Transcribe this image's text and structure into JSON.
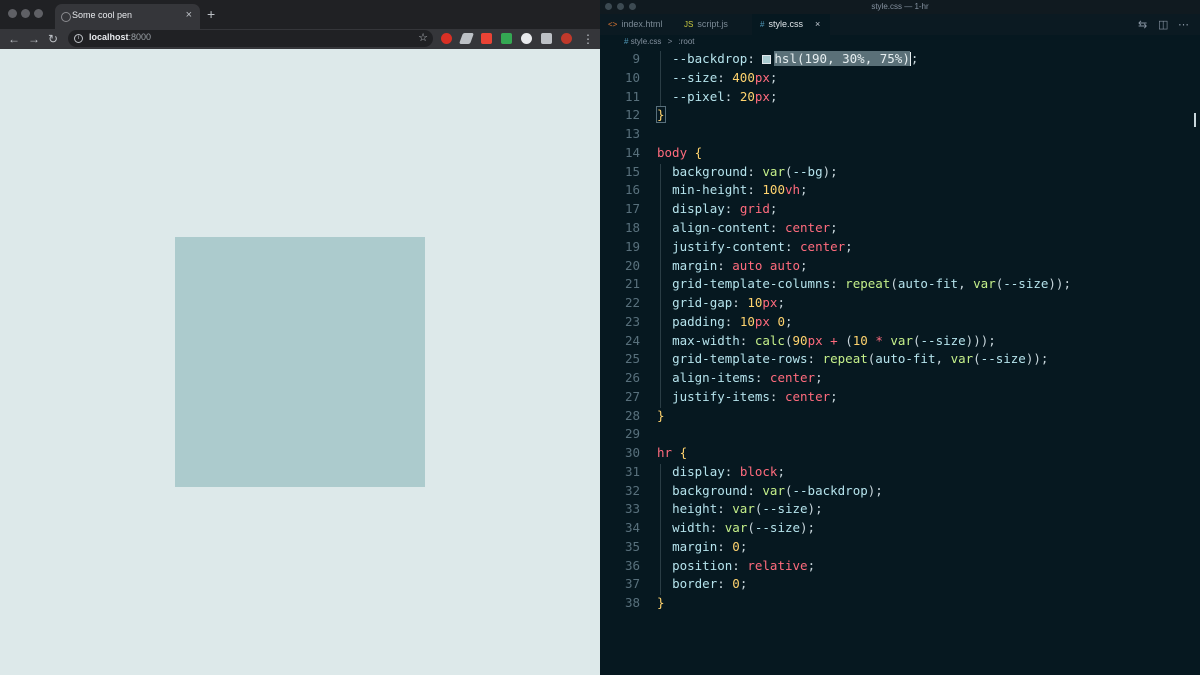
{
  "browser": {
    "tab_title": "Some cool pen",
    "tab_close": "×",
    "new_tab": "+",
    "url_host": "localhost",
    "url_port": ":8000",
    "back": "←",
    "forward": "→",
    "reload": "↻",
    "bookmark_star": "☆",
    "menu": "⋮",
    "extension_icons": [
      "shield-red-icon",
      "leaf-icon",
      "badge-red-icon",
      "green-square-icon",
      "circle-dial-icon",
      "puzzle-icon",
      "avatar-icon"
    ],
    "page_background": "#dde9ea",
    "hr_color": "#accbcd"
  },
  "editor": {
    "window_title": "style.css — 1-hr",
    "tabs": [
      {
        "icon": "<>",
        "label": "index.html"
      },
      {
        "icon": "JS",
        "label": "script.js"
      },
      {
        "icon": "#",
        "label": "style.css",
        "close": "×"
      }
    ],
    "breadcrumb": {
      "file_icon": "#",
      "file": "style.css",
      "sep": ">",
      "symbol": ":root"
    },
    "gutter": [
      "9",
      "10",
      "11",
      "12",
      "13",
      "14",
      "15",
      "16",
      "17",
      "18",
      "19",
      "20",
      "21",
      "22",
      "23",
      "24",
      "25",
      "26",
      "27",
      "28",
      "29",
      "30",
      "31",
      "32",
      "33",
      "34",
      "35",
      "36",
      "37",
      "38"
    ],
    "code": {
      "l9_prop": "--backdrop",
      "l9_value": "hsl(190, 30%, 75%)",
      "l10_prop": "--size",
      "l10_num": "400",
      "l10_unit": "px",
      "l11_prop": "--pixel",
      "l11_num": "20",
      "l11_unit": "px",
      "l12": "}",
      "l14_sel": "body",
      "l14_brace": "{",
      "l15_prop": "background",
      "l15_fn": "var",
      "l15_arg": "--bg",
      "l16_prop": "min-height",
      "l16_num": "100",
      "l16_unit": "vh",
      "l17_prop": "display",
      "l17_val": "grid",
      "l18_prop": "align-content",
      "l18_val": "center",
      "l19_prop": "justify-content",
      "l19_val": "center",
      "l20_prop": "margin",
      "l20_val": "auto auto",
      "l21_prop": "grid-template-columns",
      "l21_fn": "repeat",
      "l21_arg1": "auto-fit",
      "l21_fn2": "var",
      "l21_arg2": "--size",
      "l22_prop": "grid-gap",
      "l22_num": "10",
      "l22_unit": "px",
      "l23_prop": "padding",
      "l23_num": "10",
      "l23_unit": "px",
      "l23_num2": "0",
      "l24_prop": "max-width",
      "l24_fn": "calc",
      "l24_num": "90",
      "l24_unit": "px",
      "l24_op": "+",
      "l24_num2": "10",
      "l24_op2": "*",
      "l24_fn2": "var",
      "l24_arg": "--size",
      "l25_prop": "grid-template-rows",
      "l25_fn": "repeat",
      "l25_arg1": "auto-fit",
      "l25_fn2": "var",
      "l25_arg2": "--size",
      "l26_prop": "align-items",
      "l26_val": "center",
      "l27_prop": "justify-items",
      "l27_val": "center",
      "l28": "}",
      "l30_sel": "hr",
      "l30_brace": "{",
      "l31_prop": "display",
      "l31_val": "block",
      "l32_prop": "background",
      "l32_fn": "var",
      "l32_arg": "--backdrop",
      "l33_prop": "height",
      "l33_fn": "var",
      "l33_arg": "--size",
      "l34_prop": "width",
      "l34_fn": "var",
      "l34_arg": "--size",
      "l35_prop": "margin",
      "l35_num": "0",
      "l36_prop": "position",
      "l36_val": "relative",
      "l37_prop": "border",
      "l37_num": "0",
      "l38": "}"
    },
    "colors": {
      "background": "#061820",
      "property": "#b5e3ec",
      "keyword": "#ff6b7d",
      "number": "#ffd36e",
      "function": "#c5f08a"
    }
  }
}
